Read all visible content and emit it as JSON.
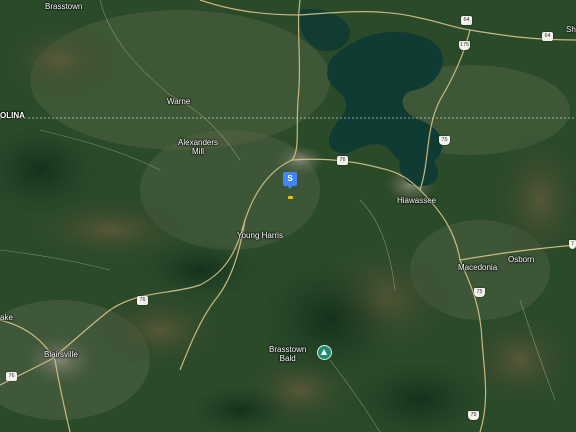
{
  "places": {
    "brasstown": "Brasstown",
    "warne": "Warne",
    "alexanders_mill_line1": "Alexanders",
    "alexanders_mill_line2": "Mill",
    "young_harris": "Young Harris",
    "hiawassee": "Hiawassee",
    "macedonia": "Macedonia",
    "osborn": "Osborn",
    "blairsville": "Blairsville",
    "brasstown_bald_line1": "Brasstown",
    "brasstown_bald_line2": "Bald",
    "state_partial": "OLINA",
    "shooting_creek_partial": "Sh",
    "lake_partial": "ake"
  },
  "route_shields": [
    {
      "id": "64a",
      "label": "64"
    },
    {
      "id": "64b",
      "label": "64"
    },
    {
      "id": "175",
      "label": "175"
    },
    {
      "id": "76a",
      "label": "76"
    },
    {
      "id": "76b",
      "label": "76"
    },
    {
      "id": "76c",
      "label": "76"
    },
    {
      "id": "75a",
      "label": "75"
    },
    {
      "id": "75b",
      "label": "75"
    },
    {
      "id": "75c",
      "label": "75"
    },
    {
      "id": "edge",
      "label": "7"
    }
  ],
  "marker": {
    "letter": "S"
  },
  "colors": {
    "terrain": "#2b4a2a",
    "water": "#0f3b33",
    "roads": "#d8c58a",
    "marker": "#4285f4",
    "peak": "#1e8e6e"
  },
  "icons": {
    "marker": "map-pin-icon",
    "peak": "mountain-peak-icon"
  }
}
